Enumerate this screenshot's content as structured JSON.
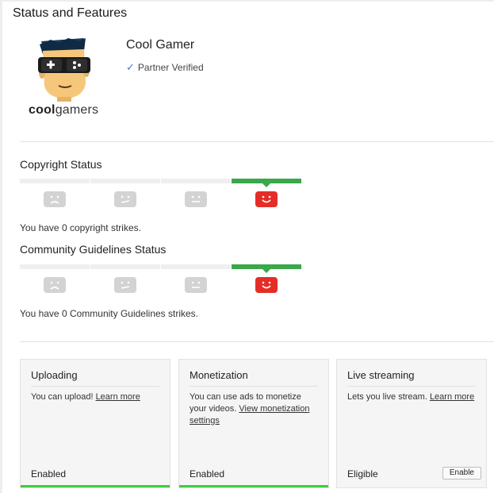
{
  "page": {
    "title": "Status and Features"
  },
  "channel": {
    "name": "Cool Gamer",
    "verified_label": "Partner Verified",
    "logo_text_bold": "cool",
    "logo_text_rest": "gamers"
  },
  "copyright": {
    "title": "Copyright Status",
    "level": 4,
    "levels": 4,
    "strike_text": "You have 0 copyright strikes."
  },
  "community": {
    "title": "Community Guidelines Status",
    "level": 4,
    "levels": 4,
    "strike_text": "You have 0 Community Guidelines strikes."
  },
  "cards": {
    "uploading": {
      "title": "Uploading",
      "text": "You can upload! ",
      "link": "Learn more",
      "status": "Enabled"
    },
    "monetization": {
      "title": "Monetization",
      "text": "You can use ads to monetize your videos. ",
      "link": "View monetization settings",
      "status": "Enabled"
    },
    "live": {
      "title": "Live streaming",
      "text": "Lets you live stream. ",
      "link": "Learn more",
      "status": "Eligible",
      "button": "Enable"
    }
  },
  "colors": {
    "active_bar": "#3aa84a",
    "active_face": "#e52d27",
    "inactive_face": "#d3d3d3",
    "enabled_bar": "#3fcc3f"
  }
}
